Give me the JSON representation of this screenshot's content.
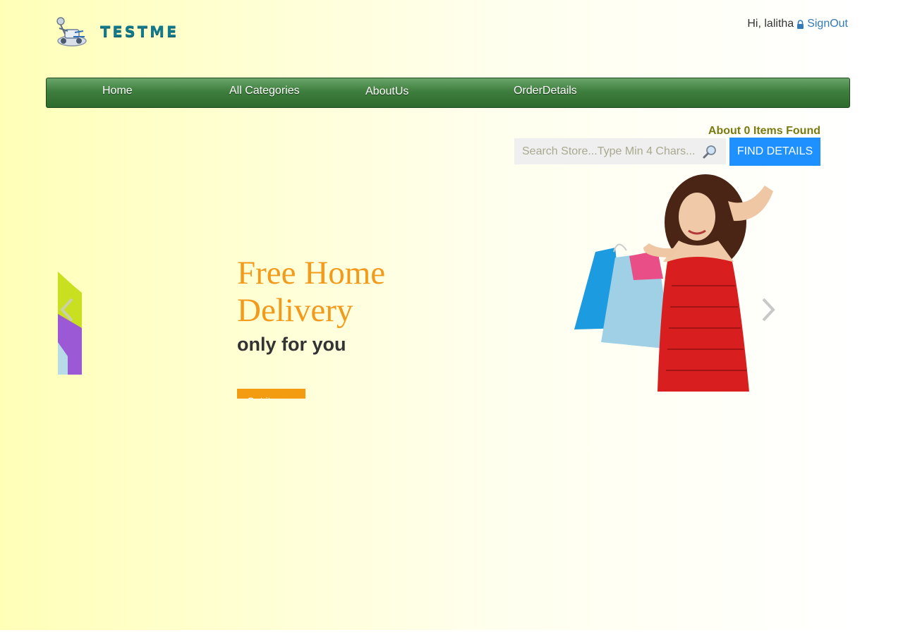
{
  "header": {
    "logo_text": "TESTME",
    "greeting": "Hi, lalitha",
    "signout_label": "SignOut",
    "icons": {
      "logo": "cart-rider-logo-icon",
      "lock": "lock-icon"
    }
  },
  "nav": {
    "items": [
      {
        "label": "Home"
      },
      {
        "label": "All Categories"
      },
      {
        "label": "AboutUs"
      },
      {
        "label": "OrderDetails"
      }
    ]
  },
  "search": {
    "found_text": "About 0 Items Found",
    "placeholder": "Search Store...Type Min 4 Chars...",
    "value": "",
    "button_label": "FIND DETAILS",
    "icon": "magnifier-icon"
  },
  "carousel": {
    "headline": "Free Home Delivery",
    "subline": "only for you",
    "cta_label": "Get it now",
    "icons": {
      "prev": "chevron-left-icon",
      "next": "chevron-right-icon"
    }
  },
  "colors": {
    "nav_green": "#3e7e3e",
    "button_blue": "#1e90ff",
    "headline_orange": "#f29a1c",
    "found_olive": "#7a7a10",
    "link_blue": "#337ab7"
  }
}
